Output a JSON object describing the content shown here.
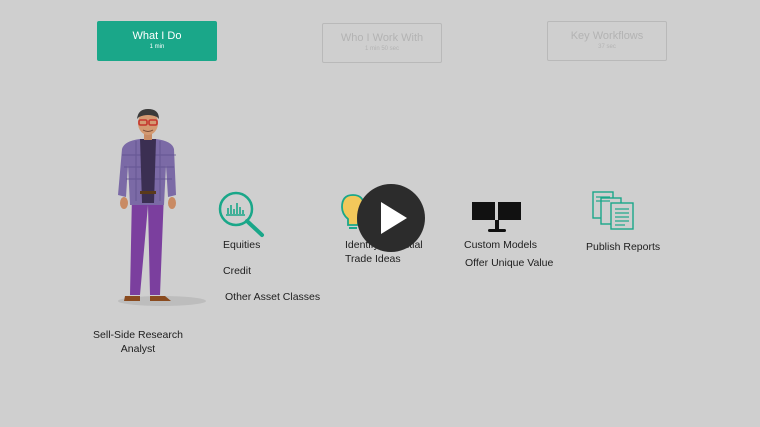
{
  "tabs": [
    {
      "title": "What I Do",
      "duration": "1 min",
      "active": true
    },
    {
      "title": "Who I Work With",
      "duration": "1 min 50 sec",
      "active": false
    },
    {
      "title": "Key Workflows",
      "duration": "37 sec",
      "active": false
    }
  ],
  "persona": {
    "line1": "Sell-Side Research",
    "line2": "Analyst"
  },
  "equities": {
    "label1": "Equities",
    "label2": "Credit",
    "label3": "Other Asset Classes",
    "icon": "magnifier-chart-icon"
  },
  "ideas": {
    "line1": "Identify Potential",
    "line2": "Trade Ideas",
    "icon": "lightbulb-icon"
  },
  "models": {
    "line1": "Custom Models",
    "line2": "Offer Unique Value",
    "icon": "dual-monitor-icon"
  },
  "reports": {
    "line1": "Publish Reports",
    "icon": "documents-icon"
  },
  "player": {
    "icon": "play-icon"
  },
  "colors": {
    "accent": "#1aa789",
    "background": "#cfcfcf",
    "player": "#2c2c2c"
  }
}
